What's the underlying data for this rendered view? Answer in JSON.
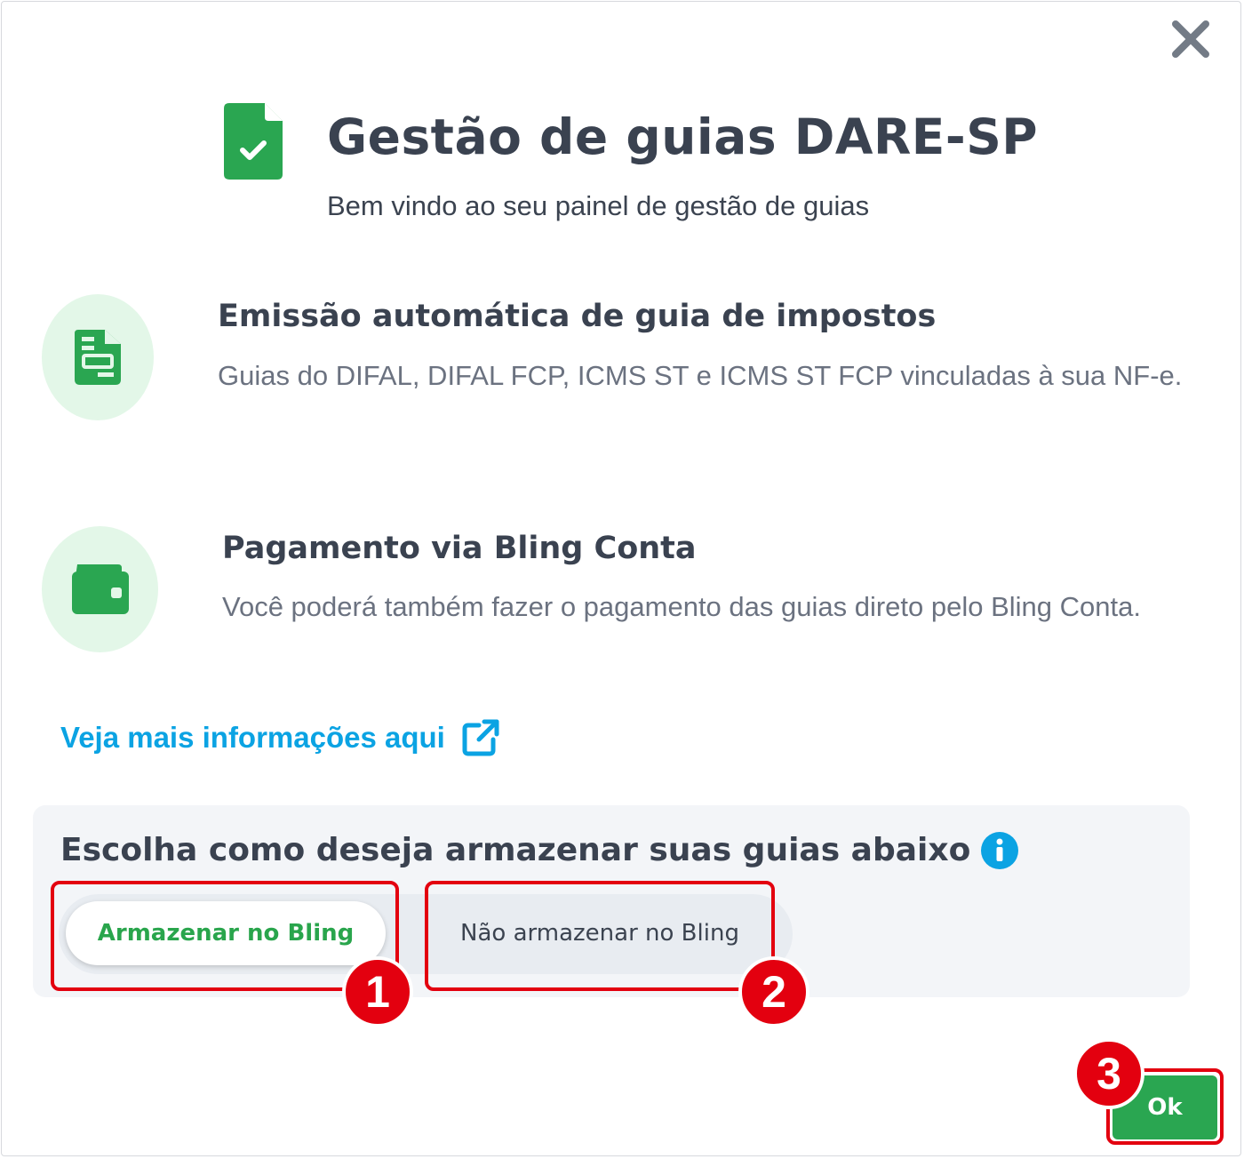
{
  "dialog": {
    "title": "Gestão de guias DARE-SP",
    "subtitle": "Bem vindo ao seu painel de gestão de guias",
    "close_icon": "close-icon",
    "header_icon": "document-check-icon"
  },
  "features": [
    {
      "icon": "receipt-icon",
      "title": "Emissão automática de guia de impostos",
      "description": "Guias do DIFAL, DIFAL FCP, ICMS ST e ICMS ST FCP vinculadas à sua NF-e."
    },
    {
      "icon": "wallet-icon",
      "title": "Pagamento via Bling Conta",
      "description": "Você poderá também fazer o pagamento das guias direto pelo Bling Conta."
    }
  ],
  "more_info": {
    "label": "Veja mais informações aqui",
    "icon": "external-link-icon"
  },
  "storage": {
    "title": "Escolha como deseja armazenar suas guias abaixo",
    "info_icon": "info-icon",
    "options": [
      {
        "label": "Armazenar no Bling",
        "selected": true
      },
      {
        "label": "Não armazenar no Bling",
        "selected": false
      }
    ]
  },
  "ok_label": "Ok",
  "annotations": [
    "1",
    "2",
    "3"
  ],
  "colors": {
    "brand_green": "#2aa651",
    "link_blue": "#0ba3e3",
    "annotation_red": "#e3000f",
    "feature_circle_bg": "#e3f7e8"
  }
}
